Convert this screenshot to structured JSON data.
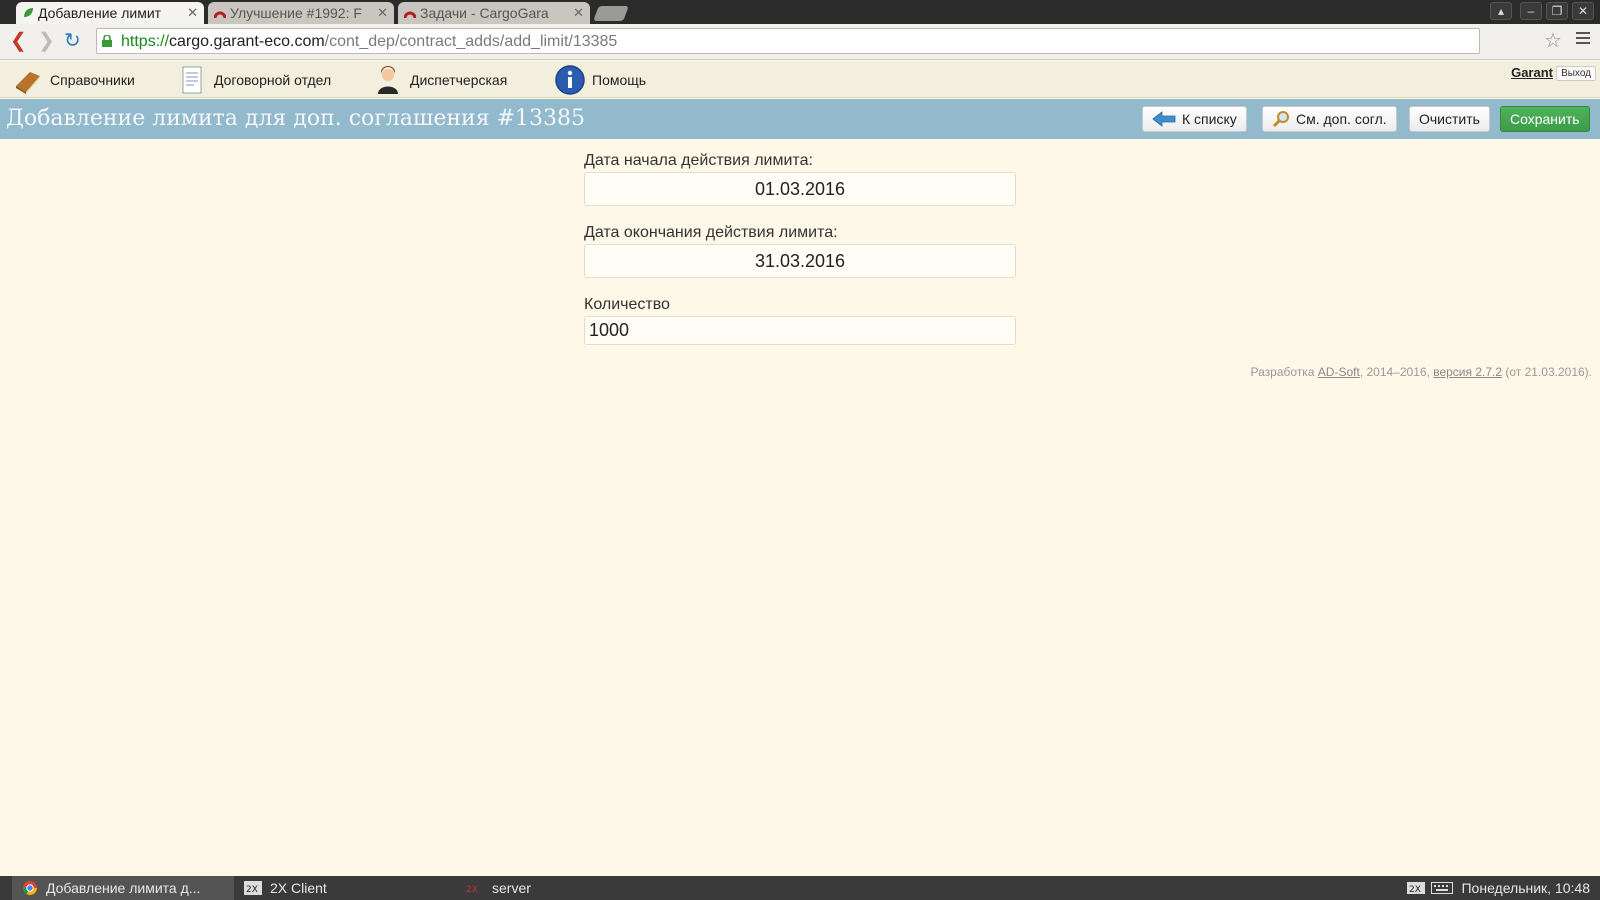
{
  "browser": {
    "tabs": [
      {
        "title": "Добавление лимит",
        "active": true,
        "icon": "leaf-icon"
      },
      {
        "title": "Улучшение #1992: F",
        "active": false,
        "icon": "redmine-icon"
      },
      {
        "title": "Задачи - CargoGara",
        "active": false,
        "icon": "redmine-icon"
      }
    ],
    "url": {
      "scheme": "https://",
      "host": "cargo.garant-eco.com",
      "path": "/cont_dep/contract_adds/add_limit/13385"
    }
  },
  "app_menu": {
    "items": [
      {
        "label": "Справочники",
        "icon": "books-icon"
      },
      {
        "label": "Договорной отдел",
        "icon": "document-icon"
      },
      {
        "label": "Диспетчерская",
        "icon": "dispatcher-icon"
      },
      {
        "label": "Помощь",
        "icon": "info-icon"
      }
    ],
    "user": "Garant",
    "logout": "Выход"
  },
  "page": {
    "title": "Добавление лимита для доп. соглашения #13385",
    "buttons": {
      "back": "К списку",
      "view": "См. доп. согл.",
      "clear": "Очистить",
      "save": "Сохранить"
    }
  },
  "form": {
    "start_label": "Дата начала действия лимита:",
    "start_value": "01.03.2016",
    "end_label": "Дата окончания действия лимита:",
    "end_value": "31.03.2016",
    "qty_label": "Количество",
    "qty_value": "1000"
  },
  "footer": {
    "prefix": "Разработка ",
    "company": "AD-Soft",
    "years": ", 2014–2016, ",
    "version": "версия 2.7.2",
    "date": " (от 21.03.2016)."
  },
  "taskbar": {
    "items": [
      {
        "label": "Добавление лимита д...",
        "icon": "chrome-icon"
      },
      {
        "label": "2X Client",
        "icon": "2x-icon"
      },
      {
        "label": "server",
        "icon": "2x-server-icon"
      }
    ],
    "clock": "Понедельник, 10:48"
  },
  "colors": {
    "page_bg": "#fef8e8",
    "title_bar": "#93b9cd",
    "save_button": "#43a34f",
    "url_scheme": "#1a8a1a"
  }
}
